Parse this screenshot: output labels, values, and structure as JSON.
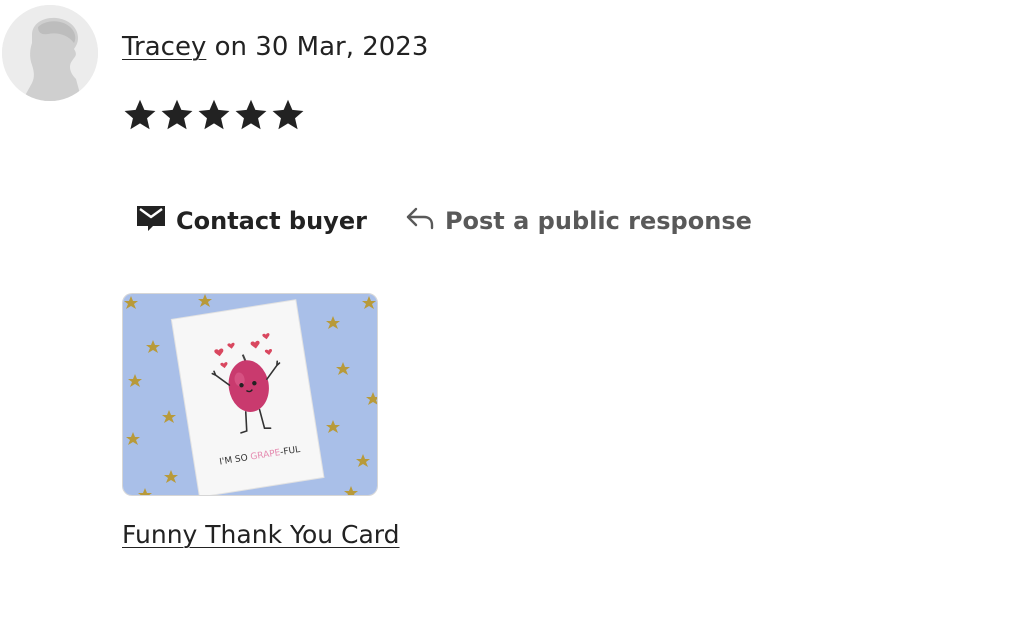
{
  "review": {
    "reviewer_name": "Tracey",
    "date_text": " on 30 Mar, 2023",
    "rating": 5,
    "rating_max": 5
  },
  "actions": {
    "contact_label": "Contact buyer",
    "respond_label": "Post a public response"
  },
  "listing": {
    "title": "Funny Thank You Card",
    "card_text_prefix": "I'M SO ",
    "card_text_highlight": "GRAPE",
    "card_text_suffix": "-FUL"
  },
  "colors": {
    "text": "#222222",
    "muted": "#595959",
    "card_bg": "#a9bfe8",
    "grape": "#c93a6e",
    "heart": "#d9475f",
    "star_gold": "#b89a3a"
  },
  "icons": {
    "avatar": "user-silhouette-icon",
    "contact": "message-icon",
    "respond": "reply-arrow-icon",
    "star": "star-icon"
  }
}
